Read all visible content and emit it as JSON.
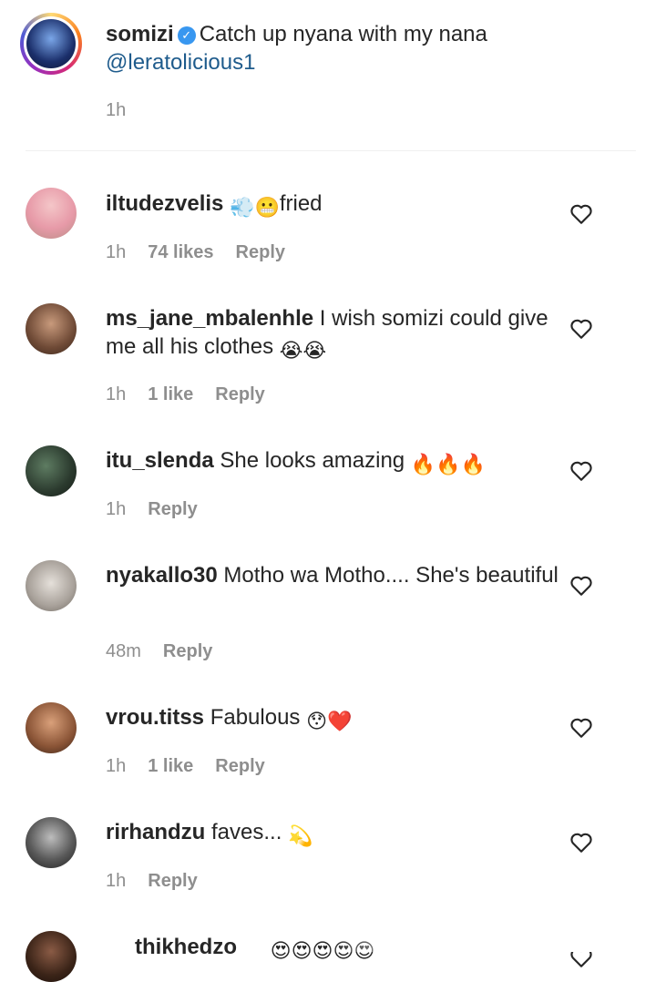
{
  "post": {
    "username": "somizi",
    "caption": "Catch up nyana with my nana",
    "mention": "@leratolicious1",
    "time": "1h"
  },
  "comments": [
    {
      "username": "iltudezvelis",
      "text": "",
      "emojis": "💨😬",
      "after": "fried",
      "time": "1h",
      "likes": "74 likes",
      "reply": "Reply"
    },
    {
      "username": "ms_jane_mbalenhle",
      "text": "I wish somizi could give me all his clothes",
      "emojis": "😭😭",
      "after": "",
      "time": "1h",
      "likes": "1 like",
      "reply": "Reply"
    },
    {
      "username": "itu_slenda",
      "text": "She looks amazing",
      "emojis": "🔥🔥🔥",
      "after": "",
      "time": "1h",
      "likes": "",
      "reply": "Reply"
    },
    {
      "username": "nyakallo30",
      "text": "Motho wa Motho.... She's beautiful",
      "emojis": "",
      "after": "",
      "time": "48m",
      "likes": "",
      "reply": "Reply"
    },
    {
      "username": "vrou.titss",
      "text": "Fabulous",
      "emojis": "😯❤️",
      "after": "",
      "time": "1h",
      "likes": "1 like",
      "reply": "Reply"
    },
    {
      "username": "rirhandzu",
      "text": "faves...",
      "emojis": "💫",
      "after": "",
      "time": "1h",
      "likes": "",
      "reply": "Reply"
    },
    {
      "username": "thikhedzo",
      "text": "",
      "emojis": "😍😍😍😍😍",
      "after": "",
      "time": "",
      "likes": "",
      "reply": ""
    }
  ],
  "icons": {
    "heart": "heart-outline-icon",
    "verified": "verified-badge-icon"
  },
  "colors": {
    "link": "#1e5b8c",
    "meta": "#8e8e8e",
    "verified": "#3897f0",
    "story_ring": "#d6249f"
  }
}
